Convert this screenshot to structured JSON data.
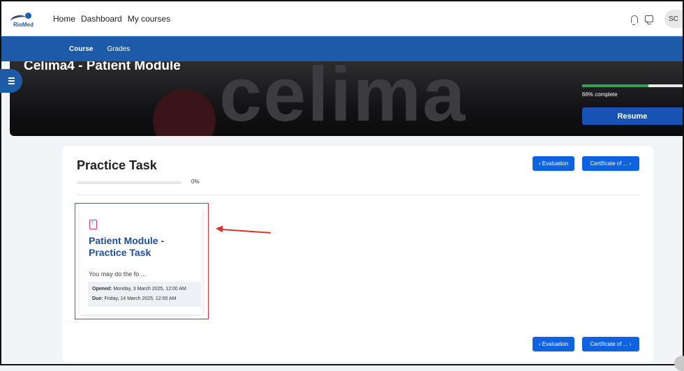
{
  "topbar": {
    "logo_text": "RioMed",
    "nav": [
      "Home",
      "Dashboard",
      "My courses"
    ],
    "avatar_initials": "SC"
  },
  "subnav": {
    "tabs": [
      "Course",
      "Grades"
    ]
  },
  "hero": {
    "title": "Celima4 - Patient Module",
    "watermark": "celima",
    "progress_percent": 66,
    "progress_label": "66% complete",
    "resume_label": "Resume"
  },
  "section": {
    "title": "Practice Task",
    "progress_percent": 0,
    "progress_label": "0%",
    "prev_button": "‹ Evaluation",
    "next_button": "Certificate of ... ›"
  },
  "activity": {
    "title": "Patient Module - Practice Task",
    "description": "You may do the fo ...",
    "opened_label": "Opened:",
    "opened_value": "Monday, 3 March 2025, 12:00 AM",
    "due_label": "Due:",
    "due_value": "Friday, 14 March 2025, 12:00 AM"
  },
  "colors": {
    "primary_blue": "#1d5aa8",
    "button_blue": "#0f62e0",
    "annotation_red": "#d9342b",
    "progress_green": "#2ea44f"
  }
}
